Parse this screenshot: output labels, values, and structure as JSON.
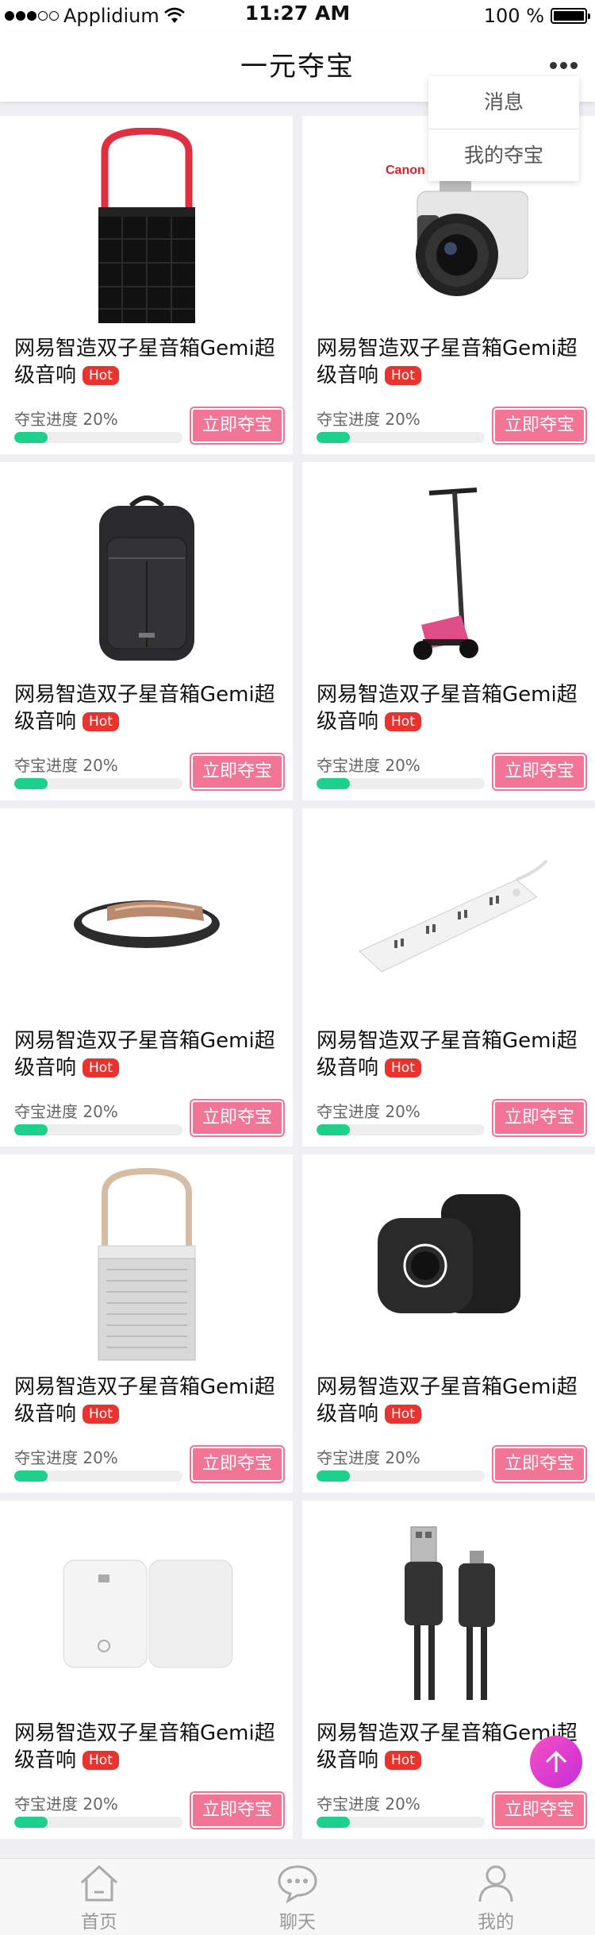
{
  "status_bar": {
    "carrier": "Applidium",
    "time": "11:27 AM",
    "battery": "100 %"
  },
  "nav": {
    "title": "一元夺宝",
    "more_icon": "more-dots-icon"
  },
  "menu": {
    "items": [
      {
        "label": "消息"
      },
      {
        "label": "我的夺宝"
      }
    ]
  },
  "products": [
    {
      "title": "网易智造双子星音箱Gemi超级音响",
      "badge": "Hot",
      "progress_label": "夺宝进度 20%",
      "progress": 0.2,
      "button": "立即夺宝",
      "image": "speaker-red-handle-image"
    },
    {
      "title": "网易智造双子星音箱Gemi超级音响",
      "badge": "Hot",
      "progress_label": "夺宝进度 20%",
      "progress": 0.2,
      "button": "立即夺宝",
      "image": "canon-camera-image",
      "brand_text": "Canon"
    },
    {
      "title": "网易智造双子星音箱Gemi超级音响",
      "badge": "Hot",
      "progress_label": "夺宝进度 20%",
      "progress": 0.2,
      "button": "立即夺宝",
      "image": "backpack-image"
    },
    {
      "title": "网易智造双子星音箱Gemi超级音响",
      "badge": "Hot",
      "progress_label": "夺宝进度 20%",
      "progress": 0.2,
      "button": "立即夺宝",
      "image": "electric-scooter-image"
    },
    {
      "title": "网易智造双子星音箱Gemi超级音响",
      "badge": "Hot",
      "progress_label": "夺宝进度 20%",
      "progress": 0.2,
      "button": "立即夺宝",
      "image": "fitness-band-image"
    },
    {
      "title": "网易智造双子星音箱Gemi超级音响",
      "badge": "Hot",
      "progress_label": "夺宝进度 20%",
      "progress": 0.2,
      "button": "立即夺宝",
      "image": "power-strip-image"
    },
    {
      "title": "网易智造双子星音箱Gemi超级音响",
      "badge": "Hot",
      "progress_label": "夺宝进度 20%",
      "progress": 0.2,
      "button": "立即夺宝",
      "image": "speaker-beige-handle-image"
    },
    {
      "title": "网易智造双子星音箱Gemi超级音响",
      "badge": "Hot",
      "progress_label": "夺宝进度 20%",
      "progress": 0.2,
      "button": "立即夺宝",
      "image": "smart-speaker-black-image"
    },
    {
      "title": "网易智造双子星音箱Gemi超级音响",
      "badge": "Hot",
      "progress_label": "夺宝进度 20%",
      "progress": 0.2,
      "button": "立即夺宝",
      "image": "white-router-image"
    },
    {
      "title": "网易智造双子星音箱Gemi超级音响",
      "badge": "Hot",
      "progress_label": "夺宝进度 20%",
      "progress": 0.2,
      "button": "立即夺宝",
      "image": "usb-cable-image"
    }
  ],
  "fab": {
    "icon": "arrow-up-icon"
  },
  "tabs": [
    {
      "label": "首页",
      "icon": "home-icon"
    },
    {
      "label": "聊天",
      "icon": "chat-icon"
    },
    {
      "label": "我的",
      "icon": "user-icon"
    }
  ],
  "colors": {
    "accent_pink": "#f27596",
    "progress_green": "#1dd08b",
    "hot_red": "#e8332f",
    "fab_magenta": "#e040cf"
  }
}
